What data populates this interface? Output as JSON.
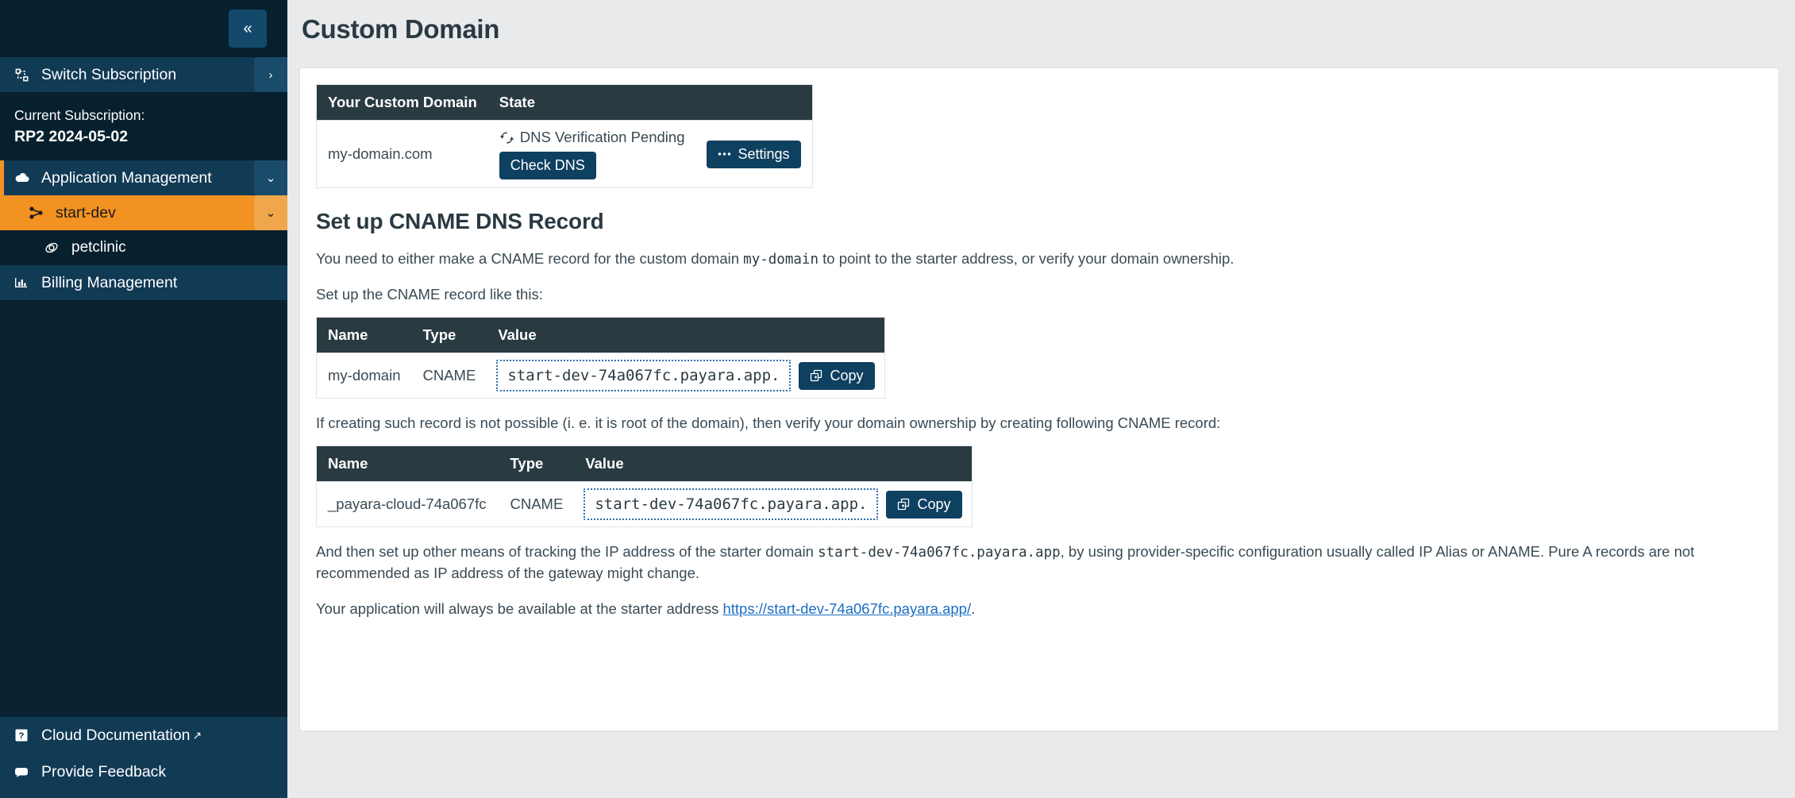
{
  "sidebar": {
    "collapse_label": "«",
    "switch_subscription": {
      "label": "Switch Subscription",
      "chevron": "›",
      "icon": "switch-icon"
    },
    "current_subscription_label": "Current Subscription:",
    "current_subscription_value": "RP2 2024-05-02",
    "application_management": {
      "label": "Application Management",
      "chevron": "⌄"
    },
    "start_dev": {
      "label": "start-dev",
      "chevron": "⌄"
    },
    "petclinic": {
      "label": "petclinic"
    },
    "billing_management": {
      "label": "Billing Management"
    },
    "cloud_documentation": {
      "label": "Cloud Documentation",
      "external": "↗"
    },
    "provide_feedback": {
      "label": "Provide Feedback"
    },
    "accent_color": "#f29222",
    "bg_color": "#0a2332"
  },
  "page": {
    "title": "Custom Domain"
  },
  "domain_table": {
    "headers": [
      "Your Custom Domain",
      "State",
      ""
    ],
    "row": {
      "domain": "my-domain.com",
      "state": "DNS Verification Pending",
      "state_icon": "refresh-icon",
      "check_dns_label": "Check DNS",
      "settings_label": "Settings",
      "settings_icon": "ellipsis-icon"
    }
  },
  "cname_section": {
    "heading": "Set up CNAME DNS Record",
    "intro_pre": "You need to either make a CNAME record for the custom domain ",
    "intro_code": "my-domain",
    "intro_post": " to point to the starter address, or verify your domain ownership.",
    "setup_line": "Set up the CNAME record like this:",
    "table1": {
      "headers": [
        "Name",
        "Type",
        "Value"
      ],
      "row": {
        "name": "my-domain",
        "type": "CNAME",
        "value": "start-dev-74a067fc.payara.app.",
        "copy_label": "Copy",
        "copy_icon": "copy-icon"
      }
    },
    "fallback_line": "If creating such record is not possible (i. e. it is root of the domain), then verify your domain ownership by creating following CNAME record:",
    "table2": {
      "headers": [
        "Name",
        "Type",
        "Value"
      ],
      "row": {
        "name": "_payara-cloud-74a067fc",
        "type": "CNAME",
        "value": "start-dev-74a067fc.payara.app.",
        "copy_label": "Copy",
        "copy_icon": "copy-icon"
      }
    },
    "tracking_pre": "And then set up other means of tracking the IP address of the starter domain ",
    "tracking_code": "start-dev-74a067fc.payara.app",
    "tracking_post": ", by using provider-specific configuration usually called IP Alias or ANAME. Pure A records are not recommended as IP address of the gateway might change.",
    "final_pre": "Your application will always be available at the starter address ",
    "final_link": "https://start-dev-74a067fc.payara.app/",
    "final_post": "."
  }
}
